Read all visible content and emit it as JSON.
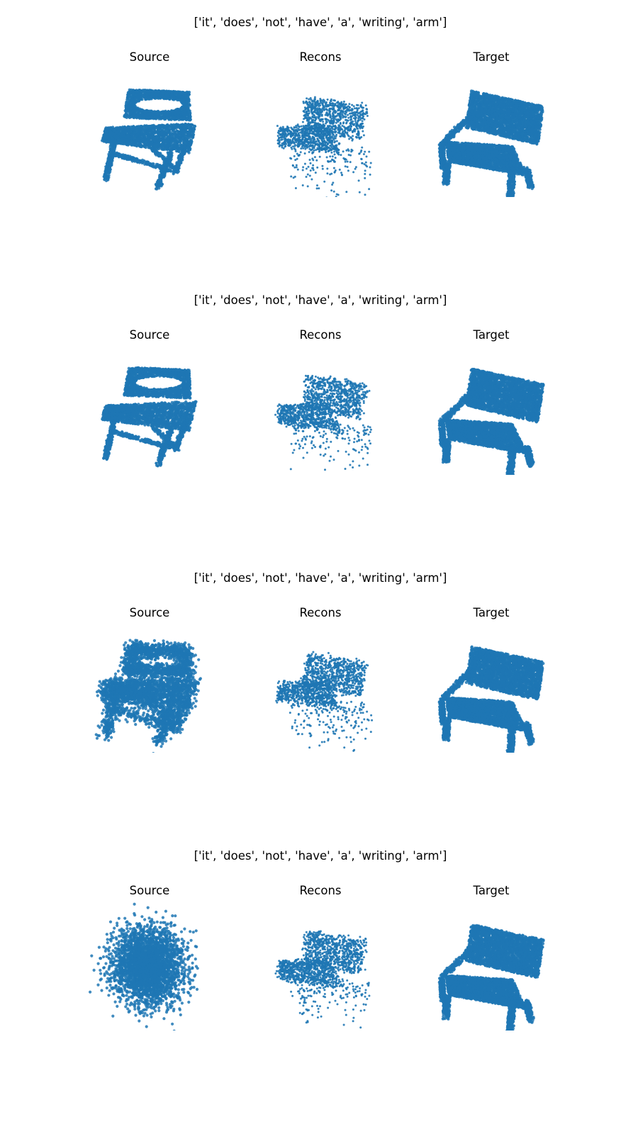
{
  "figure": {
    "rows": [
      {
        "caption": "['it', 'does', 'not', 'have', 'a', 'writing', 'arm']",
        "panels": [
          {
            "title": "Source",
            "icon": "folding-chair-point-cloud-icon"
          },
          {
            "title": "Recons",
            "icon": "noisy-chair-point-cloud-icon"
          },
          {
            "title": "Target",
            "icon": "armchair-point-cloud-icon"
          }
        ]
      },
      {
        "caption": "['it', 'does', 'not', 'have', 'a', 'writing', 'arm']",
        "panels": [
          {
            "title": "Source",
            "icon": "folding-chair-point-cloud-icon"
          },
          {
            "title": "Recons",
            "icon": "noisy-chair-point-cloud-icon"
          },
          {
            "title": "Target",
            "icon": "armchair-point-cloud-icon"
          }
        ]
      },
      {
        "caption": "['it', 'does', 'not', 'have', 'a', 'writing', 'arm']",
        "panels": [
          {
            "title": "Source",
            "icon": "blurred-chair-point-cloud-icon"
          },
          {
            "title": "Recons",
            "icon": "noisy-chair-point-cloud-icon"
          },
          {
            "title": "Target",
            "icon": "armchair-point-cloud-icon"
          }
        ]
      },
      {
        "caption": "['it', 'does', 'not', 'have', 'a', 'writing', 'arm']",
        "panels": [
          {
            "title": "Source",
            "icon": "blob-point-cloud-icon"
          },
          {
            "title": "Recons",
            "icon": "noisy-chair-point-cloud-icon"
          },
          {
            "title": "Target",
            "icon": "armchair-point-cloud-icon"
          }
        ]
      }
    ],
    "point_color": "#1f77b4",
    "background_color": "#ffffff"
  }
}
